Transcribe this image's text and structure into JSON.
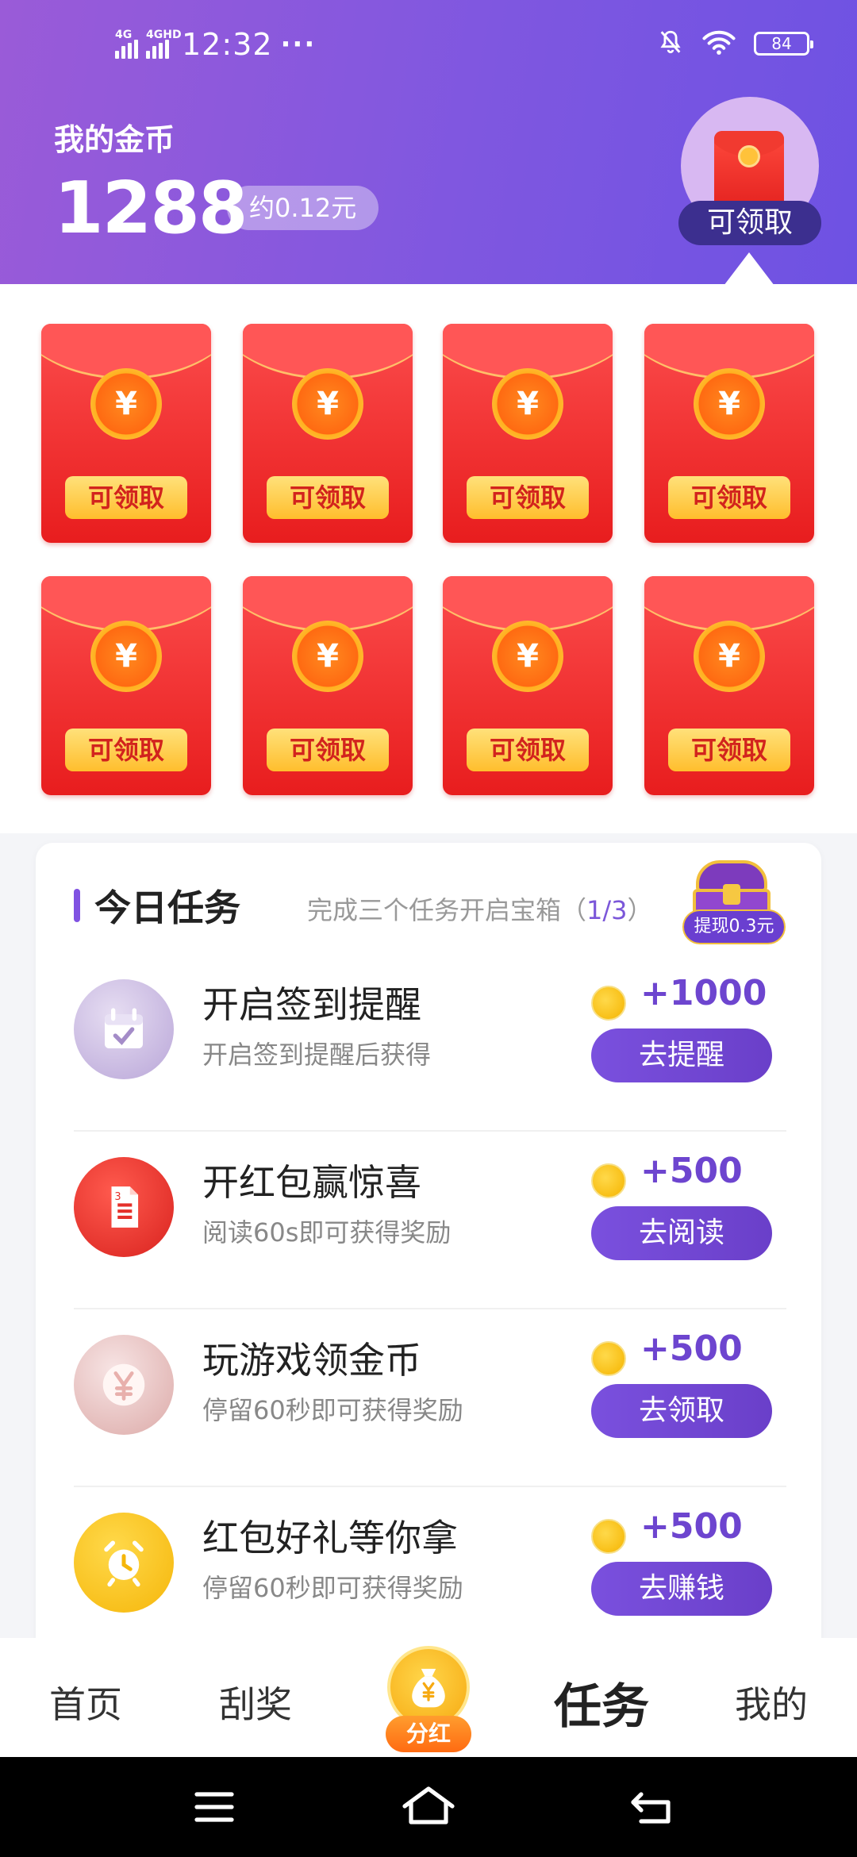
{
  "status_bar": {
    "network_1": "4G",
    "network_2": "4GHD",
    "time": "12:32",
    "more": "···",
    "battery": "84"
  },
  "header": {
    "title": "我的金币",
    "coins": "1288",
    "approx_value": "约0.12元",
    "redpacket_label": "可领取"
  },
  "envelopes": [
    {
      "label": "可领取",
      "symbol": "¥"
    },
    {
      "label": "可领取",
      "symbol": "¥"
    },
    {
      "label": "可领取",
      "symbol": "¥"
    },
    {
      "label": "可领取",
      "symbol": "¥"
    },
    {
      "label": "可领取",
      "symbol": "¥"
    },
    {
      "label": "可领取",
      "symbol": "¥"
    },
    {
      "label": "可领取",
      "symbol": "¥"
    },
    {
      "label": "可领取",
      "symbol": "¥"
    }
  ],
  "tasks_section": {
    "title": "今日任务",
    "subtitle_prefix": "完成三个任务开启宝箱（",
    "progress": "1/3",
    "subtitle_suffix": "）",
    "chest_label": "提现0.3元"
  },
  "tasks": [
    {
      "name": "开启签到提醒",
      "desc": "开启签到提醒后获得",
      "reward": "+1000",
      "button": "去提醒",
      "icon": "calendar-icon",
      "color": "#c8b8e0"
    },
    {
      "name": "开红包赢惊喜",
      "desc": "阅读60s即可获得奖励",
      "reward": "+500",
      "button": "去阅读",
      "icon": "document-icon",
      "color": "#e5302a"
    },
    {
      "name": "玩游戏领金币",
      "desc": "停留60秒即可获得奖励",
      "reward": "+500",
      "button": "去领取",
      "icon": "yuan-coin-icon",
      "color": "#e9c2c2"
    },
    {
      "name": "红包好礼等你拿",
      "desc": "停留60秒即可获得奖励",
      "reward": "+500",
      "button": "去赚钱",
      "icon": "alarm-clock-icon",
      "color": "#f7c21c"
    }
  ],
  "bottom_nav": {
    "home": "首页",
    "scratch": "刮奖",
    "center": "分红",
    "tasks": "任务",
    "mine": "我的"
  },
  "colors": {
    "accent": "#7b57d9",
    "header_start": "#9a5bd8",
    "header_end": "#6e52e3",
    "envelope_red": "#e81d1e",
    "gold": "#ffc23a"
  }
}
